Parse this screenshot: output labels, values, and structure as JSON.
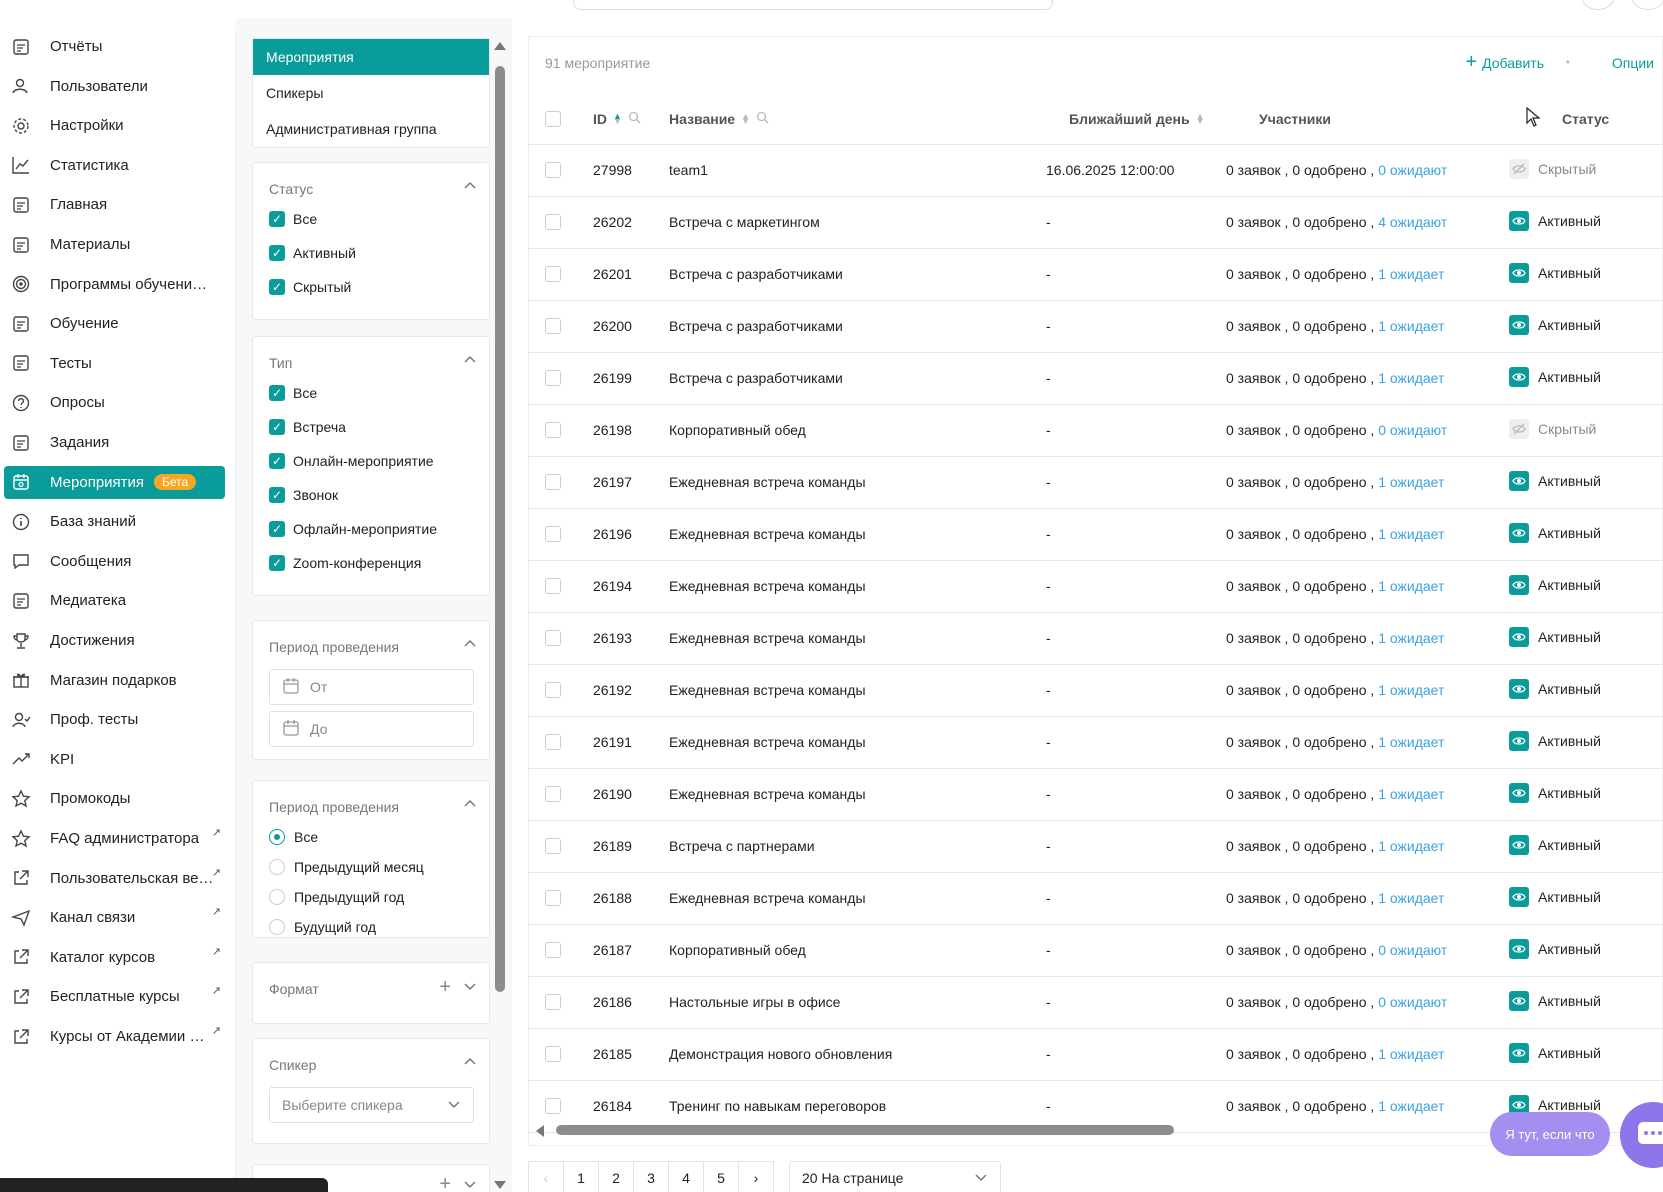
{
  "sidebar": {
    "items": [
      {
        "label": "Отчёты",
        "icon": "report-icon"
      },
      {
        "label": "Пользователи",
        "icon": "users-icon"
      },
      {
        "label": "Настройки",
        "icon": "gear-icon"
      },
      {
        "label": "Статистика",
        "icon": "chart-line-icon"
      },
      {
        "label": "Главная",
        "icon": "home-doc-icon"
      },
      {
        "label": "Материалы",
        "icon": "materials-icon"
      },
      {
        "label": "Программы обучения п...",
        "icon": "programs-icon"
      },
      {
        "label": "Обучение",
        "icon": "learning-icon"
      },
      {
        "label": "Тесты",
        "icon": "tests-icon"
      },
      {
        "label": "Опросы",
        "icon": "survey-icon"
      },
      {
        "label": "Задания",
        "icon": "tasks-icon"
      },
      {
        "label": "Мероприятия",
        "icon": "calendar-icon",
        "badge": "Бета",
        "active": true
      },
      {
        "label": "База знаний",
        "icon": "info-icon"
      },
      {
        "label": "Сообщения",
        "icon": "messages-icon"
      },
      {
        "label": "Медиатека",
        "icon": "media-icon"
      },
      {
        "label": "Достижения",
        "icon": "trophy-icon"
      },
      {
        "label": "Магазин подарков",
        "icon": "gift-icon"
      },
      {
        "label": "Проф. тесты",
        "icon": "prof-test-icon"
      },
      {
        "label": "KPI",
        "icon": "trend-icon"
      },
      {
        "label": "Промокоды",
        "icon": "star-icon"
      },
      {
        "label": "FAQ администратора",
        "icon": "star-icon",
        "external": true
      },
      {
        "label": "Пользовательская веб-...",
        "icon": "external-link-icon",
        "external": true
      },
      {
        "label": "Канал связи",
        "icon": "send-icon",
        "external": true
      },
      {
        "label": "Каталог курсов",
        "icon": "external-link-icon",
        "external": true
      },
      {
        "label": "Бесплатные курсы",
        "icon": "external-link-icon",
        "external": true
      },
      {
        "label": "Курсы от Академии Экв...",
        "icon": "external-link-icon",
        "external": true
      }
    ],
    "accent": "#0a9c9a",
    "badge_color": "#f5a623"
  },
  "filters": {
    "tabs": [
      "Мероприятия",
      "Спикеры",
      "Административная группа"
    ],
    "status": {
      "title": "Статус",
      "options": [
        "Все",
        "Активный",
        "Скрытый"
      ]
    },
    "type": {
      "title": "Тип",
      "options": [
        "Все",
        "Встреча",
        "Онлайн-мероприятие",
        "Звонок",
        "Офлайн-мероприятие",
        "Zoom-конференция"
      ]
    },
    "period_dates": {
      "title": "Период проведения",
      "from": "От",
      "to": "До"
    },
    "period_radio": {
      "title": "Период проведения",
      "options": [
        "Все",
        "Предыдущий месяц",
        "Предыдущий год",
        "Будущий год"
      ],
      "selected": 0
    },
    "format": {
      "title": "Формат"
    },
    "speaker": {
      "title": "Спикер",
      "placeholder": "Выберите спикера"
    }
  },
  "table": {
    "count": "91 мероприятие",
    "add": "Добавить",
    "options": "Опции",
    "columns": {
      "id": "ID",
      "name": "Название",
      "next_day": "Ближайший день",
      "participants": "Участники",
      "status": "Статус"
    },
    "rows": [
      {
        "id": "27998",
        "name": "team1",
        "day": "16.06.2025 12:00:00",
        "part": "0 заявок , 0 одобрено ,",
        "wait": "0 ожидают",
        "status": "Скрытый",
        "kind": "hidden"
      },
      {
        "id": "26202",
        "name": "Встреча с маркетингом",
        "day": "-",
        "part": "0 заявок , 0 одобрено ,",
        "wait": "4 ожидают",
        "status": "Активный",
        "kind": "active"
      },
      {
        "id": "26201",
        "name": "Встреча с разработчиками",
        "day": "-",
        "part": "0 заявок , 0 одобрено ,",
        "wait": "1 ожидает",
        "status": "Активный",
        "kind": "active"
      },
      {
        "id": "26200",
        "name": "Встреча с разработчиками",
        "day": "-",
        "part": "0 заявок , 0 одобрено ,",
        "wait": "1 ожидает",
        "status": "Активный",
        "kind": "active"
      },
      {
        "id": "26199",
        "name": "Встреча с разработчиками",
        "day": "-",
        "part": "0 заявок , 0 одобрено ,",
        "wait": "1 ожидает",
        "status": "Активный",
        "kind": "active"
      },
      {
        "id": "26198",
        "name": "Корпоративный обед",
        "day": "-",
        "part": "0 заявок , 0 одобрено ,",
        "wait": "0 ожидают",
        "status": "Скрытый",
        "kind": "hidden"
      },
      {
        "id": "26197",
        "name": "Ежедневная встреча команды",
        "day": "-",
        "part": "0 заявок , 0 одобрено ,",
        "wait": "1 ожидает",
        "status": "Активный",
        "kind": "active"
      },
      {
        "id": "26196",
        "name": "Ежедневная встреча команды",
        "day": "-",
        "part": "0 заявок , 0 одобрено ,",
        "wait": "1 ожидает",
        "status": "Активный",
        "kind": "active"
      },
      {
        "id": "26194",
        "name": "Ежедневная встреча команды",
        "day": "-",
        "part": "0 заявок , 0 одобрено ,",
        "wait": "1 ожидает",
        "status": "Активный",
        "kind": "active"
      },
      {
        "id": "26193",
        "name": "Ежедневная встреча команды",
        "day": "-",
        "part": "0 заявок , 0 одобрено ,",
        "wait": "1 ожидает",
        "status": "Активный",
        "kind": "active"
      },
      {
        "id": "26192",
        "name": "Ежедневная встреча команды",
        "day": "-",
        "part": "0 заявок , 0 одобрено ,",
        "wait": "1 ожидает",
        "status": "Активный",
        "kind": "active"
      },
      {
        "id": "26191",
        "name": "Ежедневная встреча команды",
        "day": "-",
        "part": "0 заявок , 0 одобрено ,",
        "wait": "1 ожидает",
        "status": "Активный",
        "kind": "active"
      },
      {
        "id": "26190",
        "name": "Ежедневная встреча команды",
        "day": "-",
        "part": "0 заявок , 0 одобрено ,",
        "wait": "1 ожидает",
        "status": "Активный",
        "kind": "active"
      },
      {
        "id": "26189",
        "name": "Встреча с партнерами",
        "day": "-",
        "part": "0 заявок , 0 одобрено ,",
        "wait": "1 ожидает",
        "status": "Активный",
        "kind": "active"
      },
      {
        "id": "26188",
        "name": "Ежедневная встреча команды",
        "day": "-",
        "part": "0 заявок , 0 одобрено ,",
        "wait": "1 ожидает",
        "status": "Активный",
        "kind": "active"
      },
      {
        "id": "26187",
        "name": "Корпоративный обед",
        "day": "-",
        "part": "0 заявок , 0 одобрено ,",
        "wait": "0 ожидают",
        "status": "Активный",
        "kind": "active"
      },
      {
        "id": "26186",
        "name": "Настольные игры в офисе",
        "day": "-",
        "part": "0 заявок , 0 одобрено ,",
        "wait": "0 ожидают",
        "status": "Активный",
        "kind": "active"
      },
      {
        "id": "26185",
        "name": "Демонстрация нового обновления",
        "day": "-",
        "part": "0 заявок , 0 одобрено ,",
        "wait": "1 ожидает",
        "status": "Активный",
        "kind": "active"
      },
      {
        "id": "26184",
        "name": "Тренинг по навыкам переговоров",
        "day": "-",
        "part": "0 заявок , 0 одобрено ,",
        "wait": "1 ожидает",
        "status": "Активный",
        "kind": "active"
      }
    ]
  },
  "pagination": {
    "pages": [
      "1",
      "2",
      "3",
      "4",
      "5"
    ],
    "prev": "‹",
    "next": "›",
    "per_page": "20 На странице"
  },
  "help": {
    "label": "Я тут, если что"
  }
}
